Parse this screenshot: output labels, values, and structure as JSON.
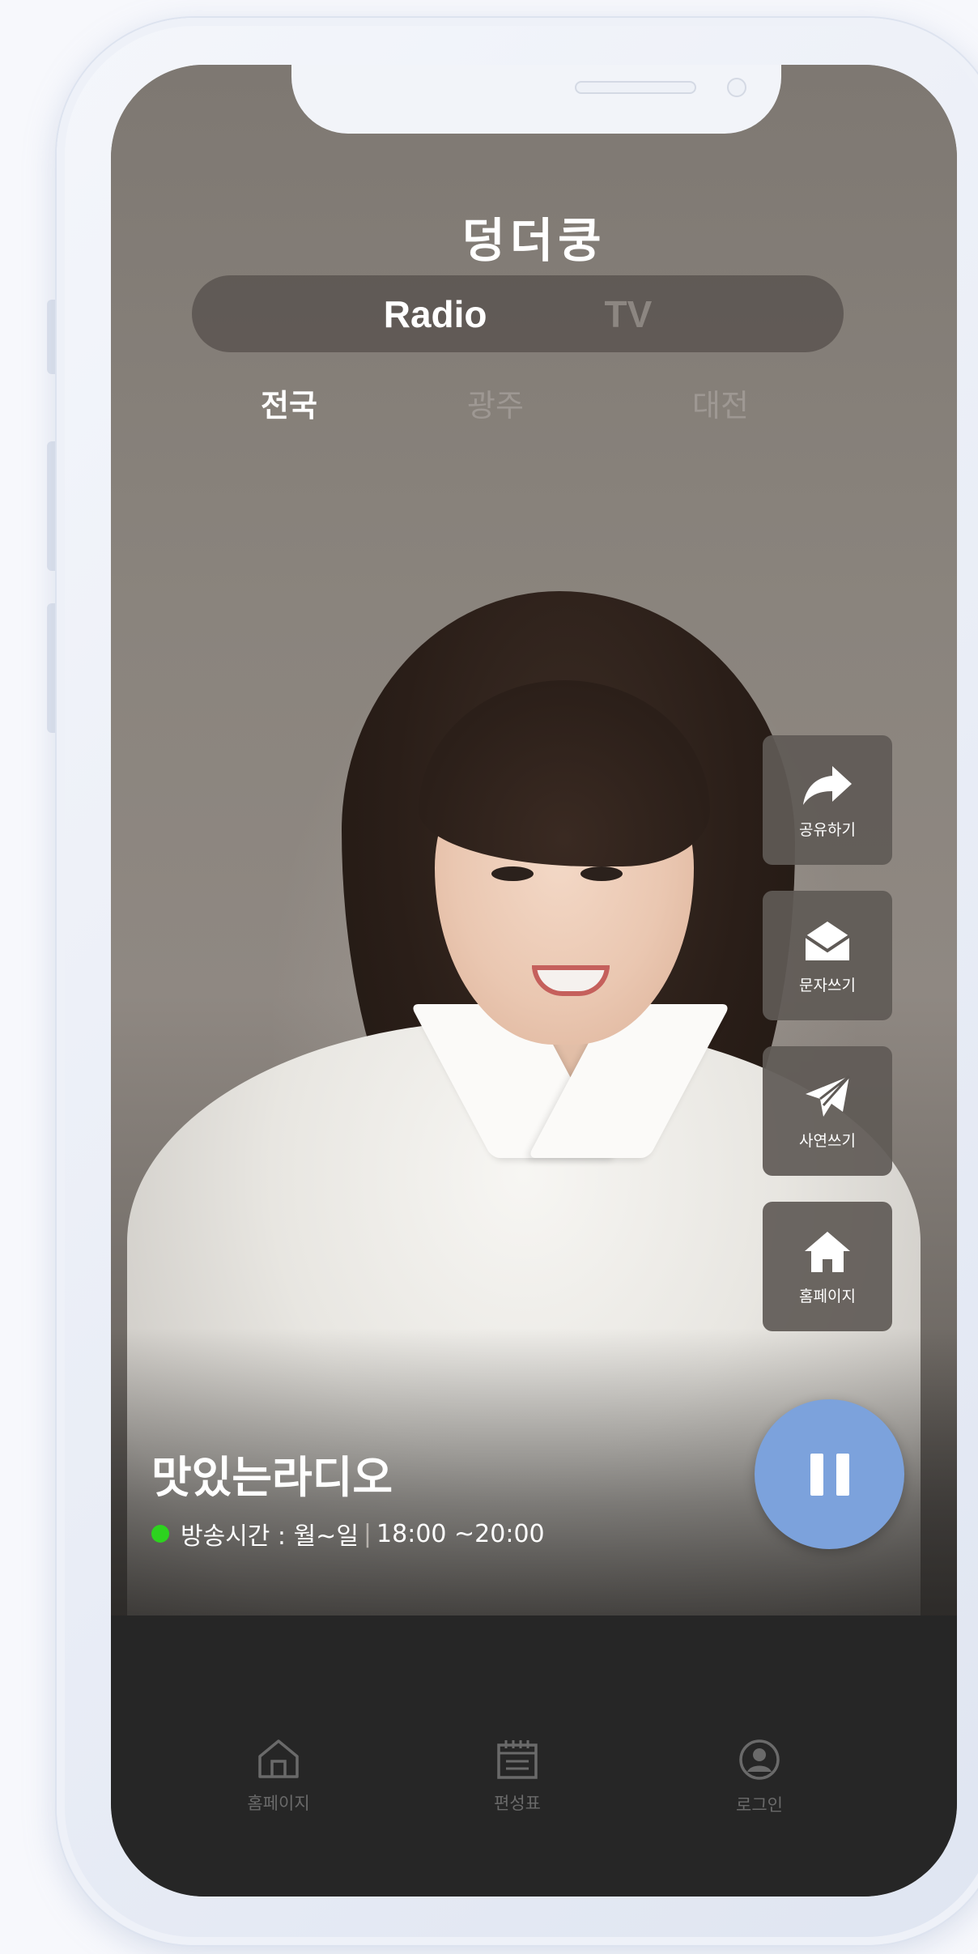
{
  "app": {
    "title": "덩더쿵"
  },
  "tabs": [
    {
      "label": "Radio",
      "active": true
    },
    {
      "label": "TV",
      "active": false
    }
  ],
  "regions": [
    {
      "label": "전국",
      "active": true
    },
    {
      "label": "광주",
      "active": false
    },
    {
      "label": "대전",
      "active": false
    }
  ],
  "actions": [
    {
      "label": "공유하기",
      "icon": "share-icon"
    },
    {
      "label": "문자쓰기",
      "icon": "envelope-icon"
    },
    {
      "label": "사연쓰기",
      "icon": "paper-plane-icon"
    },
    {
      "label": "홈페이지",
      "icon": "home-icon"
    }
  ],
  "player": {
    "state": "playing",
    "button_icon": "pause-icon",
    "accent_color": "#7ca2dc"
  },
  "program": {
    "title": "맛있는라디오",
    "schedule_label": "방송시간 : 월~일",
    "schedule_separator": "|",
    "schedule_time": "18:00 ~20:00",
    "live_color": "#2dd31f"
  },
  "bottom_nav": [
    {
      "label": "홈페이지",
      "icon": "home-outline-icon"
    },
    {
      "label": "편성표",
      "icon": "calendar-icon"
    },
    {
      "label": "로그인",
      "icon": "user-circle-icon"
    }
  ]
}
